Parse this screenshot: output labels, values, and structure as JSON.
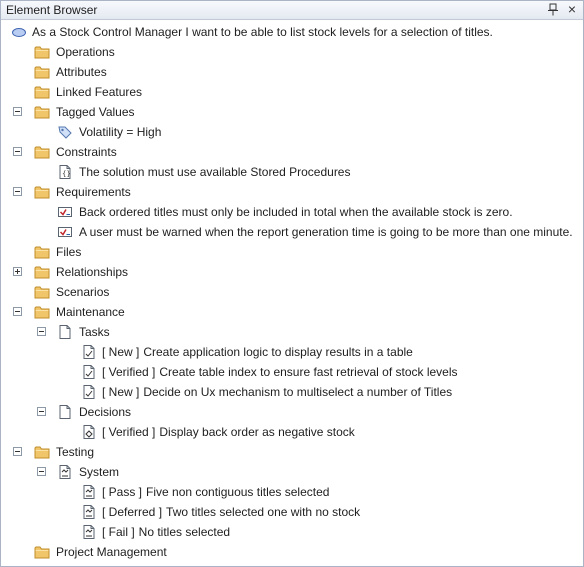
{
  "window": {
    "title": "Element Browser"
  },
  "tree": {
    "root": "As a Stock Control Manager I want to be able to list stock levels for a selection of titles.",
    "operations": "Operations",
    "attributes": "Attributes",
    "linked_features": "Linked Features",
    "tagged_values": "Tagged Values",
    "volatility": "Volatility = High",
    "constraints": "Constraints",
    "constraint_1": "The solution must use available Stored Procedures",
    "requirements": "Requirements",
    "requirement_1": "Back ordered titles must only be included in total when the available stock is zero.",
    "requirement_2": "A user must be warned when the report generation time is going to be more than one minute.",
    "files": "Files",
    "relationships": "Relationships",
    "scenarios": "Scenarios",
    "maintenance": "Maintenance",
    "tasks": "Tasks",
    "task_1_status": "[ New ]",
    "task_1_text": "Create application logic to display results in a table",
    "task_2_status": "[ Verified ]",
    "task_2_text": "Create table index to ensure fast retrieval of stock levels",
    "task_3_status": "[ New ]",
    "task_3_text": "Decide on Ux mechanism to multiselect a number of Titles",
    "decisions": "Decisions",
    "decision_1_status": "[ Verified ]",
    "decision_1_text": "Display back order as negative stock",
    "testing": "Testing",
    "system": "System",
    "test_1_status": "[ Pass ]",
    "test_1_text": "Five non contiguous titles selected",
    "test_2_status": "[ Deferred ]",
    "test_2_text": "Two titles selected one with no stock",
    "test_3_status": "[ Fail ]",
    "test_3_text": "No titles selected",
    "project_management": "Project Management"
  }
}
